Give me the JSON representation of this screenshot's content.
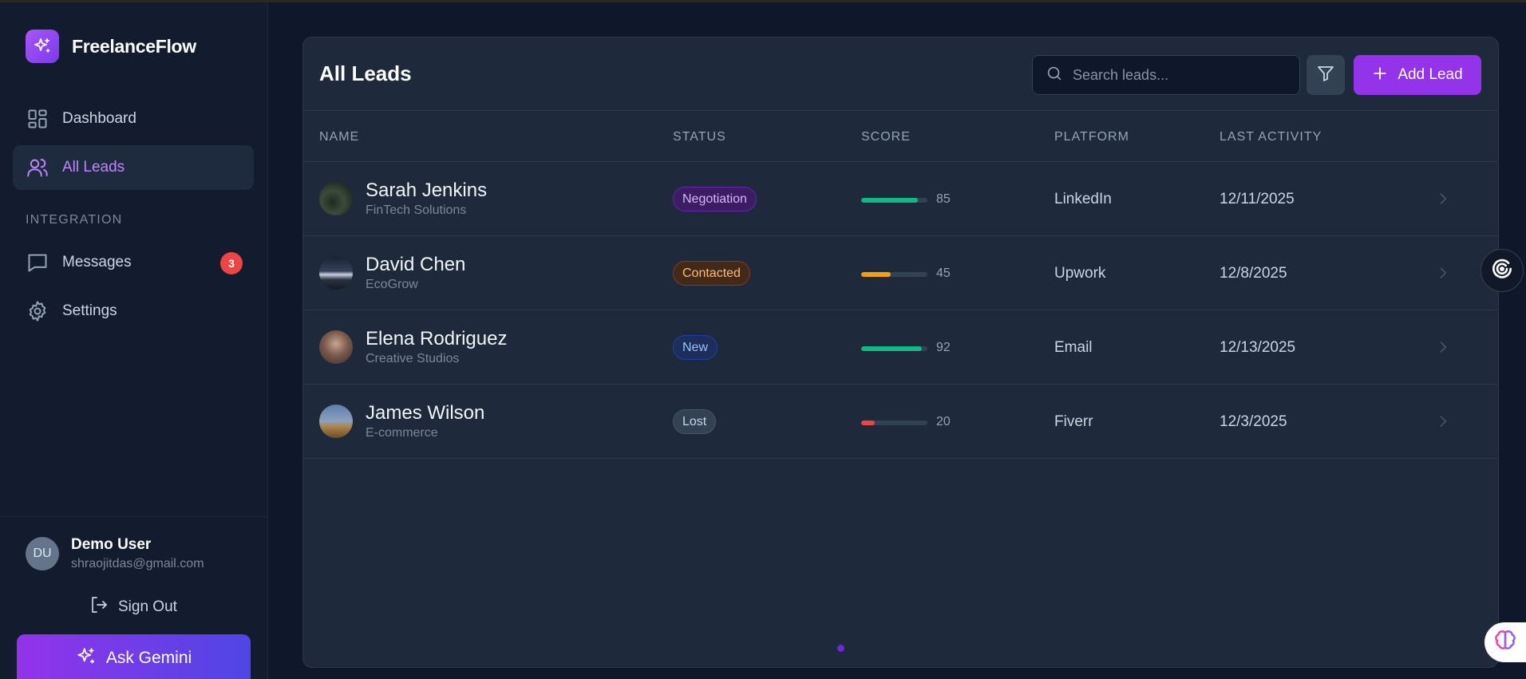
{
  "app": {
    "name": "FreelanceFlow"
  },
  "sidebar": {
    "nav": [
      {
        "label": "Dashboard",
        "icon": "dashboard-icon"
      },
      {
        "label": "All Leads",
        "icon": "users-icon",
        "active": true
      }
    ],
    "section_label": "INTEGRATION",
    "integration": [
      {
        "label": "Messages",
        "icon": "message-icon",
        "badge": "3"
      },
      {
        "label": "Settings",
        "icon": "gear-icon"
      }
    ],
    "user": {
      "initials": "DU",
      "name": "Demo User",
      "email": "shraojitdas@gmail.com"
    },
    "sign_out_label": "Sign Out",
    "ask_gemini_label": "Ask Gemini"
  },
  "main": {
    "title": "All Leads",
    "search": {
      "placeholder": "Search leads...",
      "value": ""
    },
    "add_lead_label": "Add Lead",
    "columns": [
      "NAME",
      "STATUS",
      "SCORE",
      "PLATFORM",
      "LAST ACTIVITY"
    ],
    "leads": [
      {
        "name": "Sarah Jenkins",
        "company": "FinTech Solutions",
        "status": "Negotiation",
        "score": 85,
        "score_label": "85",
        "platform": "LinkedIn",
        "last_activity": "12/11/2025"
      },
      {
        "name": "David Chen",
        "company": "EcoGrow",
        "status": "Contacted",
        "score": 45,
        "score_label": "45",
        "platform": "Upwork",
        "last_activity": "12/8/2025"
      },
      {
        "name": "Elena Rodriguez",
        "company": "Creative Studios",
        "status": "New",
        "score": 92,
        "score_label": "92",
        "platform": "Email",
        "last_activity": "12/13/2025"
      },
      {
        "name": "James Wilson",
        "company": "E-commerce",
        "status": "Lost",
        "score": 20,
        "score_label": "20",
        "platform": "Fiverr",
        "last_activity": "12/3/2025"
      }
    ]
  },
  "colors": {
    "accent": "#9333ea",
    "score_high": "#10b981",
    "score_mid": "#f59e0b",
    "score_low": "#ef4444"
  }
}
